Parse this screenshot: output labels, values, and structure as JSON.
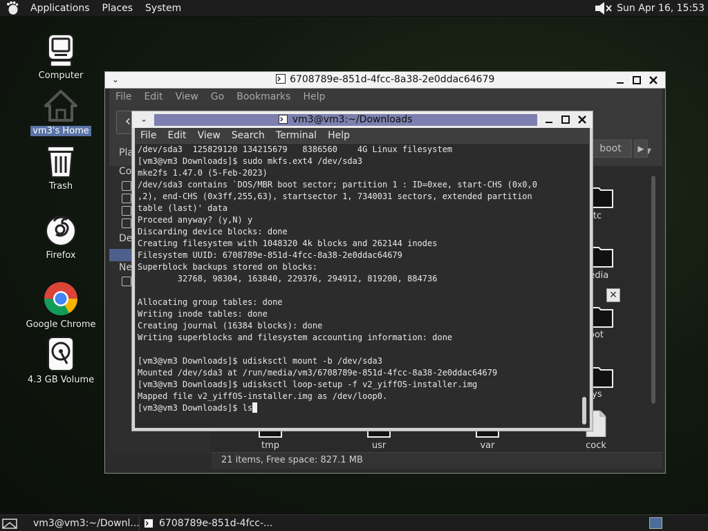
{
  "top_panel": {
    "menus": [
      "Applications",
      "Places",
      "System"
    ],
    "clock": "Sun Apr 16, 15:53",
    "logo_icon": "gnome-foot-icon",
    "volume_icon": "volume-muted-icon"
  },
  "desktop": {
    "icons": [
      {
        "label": "Computer",
        "icon": "computer-icon",
        "selected": false
      },
      {
        "label": "vm3's Home",
        "icon": "home-icon",
        "selected": true
      },
      {
        "label": "Trash",
        "icon": "trash-icon",
        "selected": false
      },
      {
        "label": "Firefox",
        "icon": "firefox-icon",
        "selected": false
      },
      {
        "label": "Google Chrome",
        "icon": "chrome-icon",
        "selected": false
      },
      {
        "label": "4.3 GB Volume",
        "icon": "drive-icon",
        "selected": false
      }
    ]
  },
  "file_manager": {
    "title": "6708789e-851d-4fcc-8a38-2e0ddac64679",
    "menus": [
      "File",
      "Edit",
      "View",
      "Go",
      "Bookmarks",
      "Help"
    ],
    "path_chip": "boot",
    "sidebar_headers": [
      "Pla",
      "Co",
      "De",
      "Ne"
    ],
    "visible_items": [
      {
        "label": "etc"
      },
      {
        "label": "media"
      },
      {
        "label": "root"
      },
      {
        "label": "sys"
      },
      {
        "label": "tmp"
      },
      {
        "label": "usr"
      },
      {
        "label": "var"
      },
      {
        "label": "cock"
      }
    ],
    "status": "21 items, Free space: 827.1 MB"
  },
  "terminal": {
    "title": "vm3@vm3:~/Downloads",
    "menus": [
      "File",
      "Edit",
      "View",
      "Search",
      "Terminal",
      "Help"
    ],
    "lines": [
      "/dev/sda3  125829120 134215679   8386560    4G Linux filesystem",
      "[vm3@vm3 Downloads]$ sudo mkfs.ext4 /dev/sda3",
      "mke2fs 1.47.0 (5-Feb-2023)",
      "/dev/sda3 contains `DOS/MBR boot sector; partition 1 : ID=0xee, start-CHS (0x0,0",
      ",2), end-CHS (0x3ff,255,63), startsector 1, 7340031 sectors, extended partition",
      "table (last)' data",
      "Proceed anyway? (y,N) y",
      "Discarding device blocks: done",
      "Creating filesystem with 1048320 4k blocks and 262144 inodes",
      "Filesystem UUID: 6708789e-851d-4fcc-8a38-2e0ddac64679",
      "Superblock backups stored on blocks:",
      "        32768, 98304, 163840, 229376, 294912, 819200, 884736",
      "",
      "Allocating group tables: done",
      "Writing inode tables: done",
      "Creating journal (16384 blocks): done",
      "Writing superblocks and filesystem accounting information: done",
      "",
      "[vm3@vm3 Downloads]$ udisksctl mount -b /dev/sda3",
      "Mounted /dev/sda3 at /run/media/vm3/6708789e-851d-4fcc-8a38-2e0ddac64679",
      "[vm3@vm3 Downloads]$ udisksctl loop-setup -f v2_yiffOS-installer.img",
      "Mapped file v2_yiffOS-installer.img as /dev/loop0.",
      "[vm3@vm3 Downloads]$ ls"
    ]
  },
  "taskbar": {
    "tasks": [
      "vm3@vm3:~/Downl...",
      "6708789e-851d-4fcc-..."
    ]
  },
  "colors": {
    "selection": "#5a72a6",
    "terminal_title_highlight": "#7d7fae",
    "panel": "#1d1d1d"
  }
}
